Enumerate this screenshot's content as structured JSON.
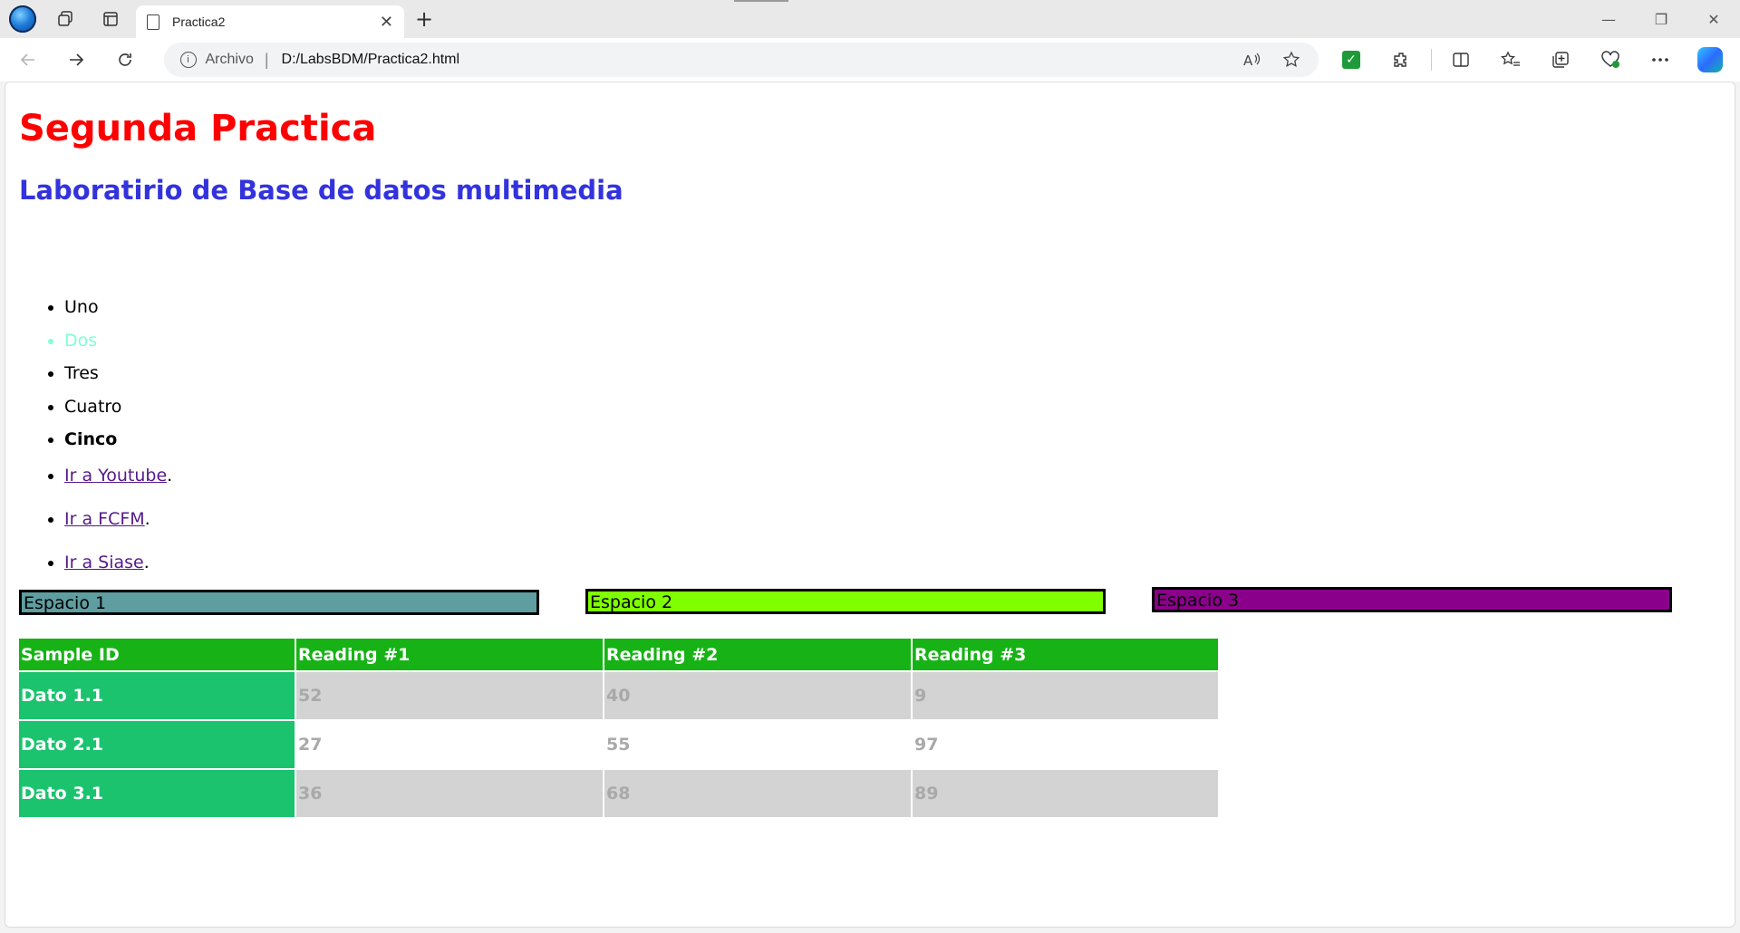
{
  "browser": {
    "tab_title": "Practica2",
    "close_glyph": "✕",
    "newtab_glyph": "+",
    "address_scheme": "Archivo",
    "address_sep": "|",
    "address_url": "D:/LabsBDM/Practica2.html",
    "window_controls": [
      "—",
      "❐",
      "✕"
    ],
    "icons": [
      "back-icon",
      "forward-icon",
      "refresh-icon",
      "info-icon",
      "read-aloud-icon",
      "favorite-star-icon",
      "extension-check-icon",
      "extensions-icon",
      "split-screen-icon",
      "favorites-icon",
      "collections-icon",
      "performance-icon",
      "more-icon",
      "copilot-icon"
    ]
  },
  "page": {
    "title": "Segunda Practica",
    "subtitle": "Laboratirio de Base de datos multimedia",
    "list_items": [
      "Uno",
      "Dos",
      "Tres",
      "Cuatro",
      "Cinco"
    ],
    "links": [
      {
        "text": "Ir a Youtube",
        "suffix": "."
      },
      {
        "text": "Ir a FCFM",
        "suffix": "."
      },
      {
        "text": "Ir a Siase",
        "suffix": "."
      }
    ],
    "espacios": [
      "Espacio 1",
      "Espacio 2",
      "Espacio 3"
    ],
    "espacio_colors": [
      "#5f9ea0",
      "#7fff00",
      "#8b008b"
    ],
    "table": {
      "headers": [
        "Sample ID",
        "Reading #1",
        "Reading #2",
        "Reading #3"
      ],
      "rows": [
        [
          "Dato 1.1",
          "52",
          "40",
          "9"
        ],
        [
          "Dato 2.1",
          "27",
          "55",
          "97"
        ],
        [
          "Dato 3.1",
          "36",
          "68",
          "89"
        ]
      ]
    },
    "colors": {
      "title": "#ff0000",
      "subtitle": "#3333dd",
      "table_header": "#17b316",
      "row_header": "#1bc36e"
    }
  }
}
